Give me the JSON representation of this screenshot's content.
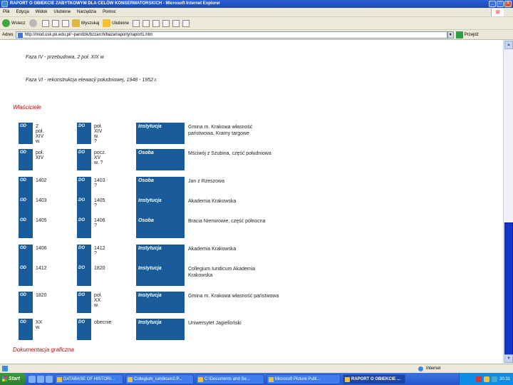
{
  "window": {
    "title": "RAPORT O OBIEKCIE ZABYTKOWYM DLA CELÓW KONSERWATORSKICH - Microsoft Internet Explorer",
    "controls": [
      "_",
      "□",
      "×"
    ]
  },
  "menu": [
    "Plik",
    "Edycja",
    "Widok",
    "Ulubione",
    "Narzędzia",
    "Pomoc"
  ],
  "toolbar": {
    "back_label": "Wstecz",
    "search_label": "Wyszukaj",
    "favorites_label": "Ulubione"
  },
  "address": {
    "label": "Adres",
    "url": "http://mod.usk.pk.edu.pl/~pandzik/bzzarch/baza/raporty/raport1.htm",
    "go_label": "Przejdź"
  },
  "content": {
    "phases": [
      "Faza IV - przebudowa, 2 poł. XIX w.",
      "Faza VI - rekonstrukcja elewacji południowej, 1948 - 1952 r."
    ],
    "owners_title": "Właściciele",
    "od_label": "OD",
    "do_label": "DO",
    "rows": [
      {
        "from": "2 poł. XIV w.",
        "to": "poł. XIV w. ?",
        "type": "Instytucja",
        "owner": "Gmina m. Krakowa własność państwowa, Kramy targowe"
      },
      {
        "from": "poł. XIV",
        "to": "pocz. XV w. ?",
        "type": "Osoba",
        "owner": "Mściwój z Szubina, część południowa"
      },
      {
        "from": "1402",
        "to": "1403 ?",
        "type": "Osoba",
        "owner": "Jan z Rzeszowa"
      },
      {
        "from": "1403",
        "to": "1405 ?",
        "type": "Instytucja",
        "owner": "Akademia Krakowska"
      },
      {
        "from": "1405",
        "to": "1406 ?",
        "type": "Osoba",
        "owner": "Bracia Niemirowie, część północna"
      },
      {
        "from": "1406",
        "to": "1412 ?",
        "type": "Instytucja",
        "owner": "Akademia Krakowska"
      },
      {
        "from": "1412",
        "to": "1820",
        "type": "Instytucja",
        "owner": "Collegium Iuridicum Akademia Krakowska"
      },
      {
        "from": "1820",
        "to": "poł. XX w.",
        "type": "Instytucja",
        "owner": "Gmina m. Krakowa własność państwowa"
      },
      {
        "from": "XX w.",
        "to": "obecnie",
        "type": "Instytucja",
        "owner": "Uniwersytet Jagielloński"
      }
    ],
    "docs_title": "Dokumentacja graficzna"
  },
  "status": {
    "zone": "Internet"
  },
  "taskbar": {
    "start_label": "Start",
    "tasks": [
      "DATABASE OF HISTORI...",
      "Collegium_Iuridicum2.P...",
      "C:\\Documents and Se...",
      "Microsoft Picture Publ...",
      "RAPORT O OBIEKCIE ..."
    ],
    "clock": "20:31"
  },
  "colors": {
    "badge_blue": "#1a5c9a",
    "section_red": "#b01010",
    "scroll_thumb": "#1535c8"
  }
}
